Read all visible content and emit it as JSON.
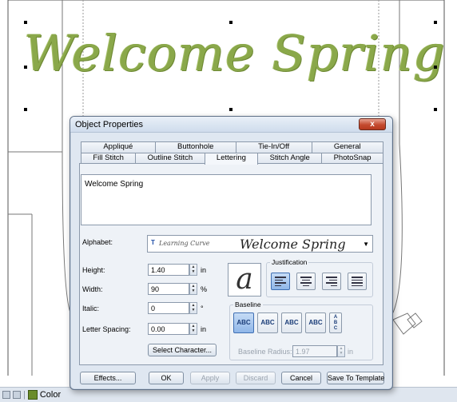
{
  "canvas": {
    "embroidery_text": "Welcome Spring"
  },
  "statusbar": {
    "color_label": "Color"
  },
  "dialog": {
    "title": "Object Properties",
    "close_label": "x",
    "tabs_row1": [
      "Appliqué",
      "Buttonhole",
      "Tie-In/Off",
      "General"
    ],
    "tabs_row2": [
      "Fill Stitch",
      "Outline Stitch",
      "Lettering",
      "Stitch Angle",
      "PhotoSnap"
    ],
    "active_tab": "Lettering",
    "text_value": "Welcome Spring",
    "alphabet_label": "Alphabet:",
    "alphabet_font_name": "Learning Curve",
    "alphabet_preview": "Welcome Spring",
    "height_label": "Height:",
    "height_value": "1.40",
    "height_unit": "in",
    "width_label": "Width:",
    "width_value": "90",
    "width_unit": "%",
    "italic_label": "Italic:",
    "italic_value": "0",
    "italic_unit": "°",
    "spacing_label": "Letter Spacing:",
    "spacing_value": "0.00",
    "spacing_unit": "in",
    "select_character_label": "Select Character...",
    "preview_glyph": "a",
    "justification_label": "Justification",
    "baseline_label": "Baseline",
    "baseline_buttons": [
      "ABC",
      "ABC",
      "ABC",
      "ABC",
      "ABC"
    ],
    "baseline_radius_label": "Baseline Radius:",
    "baseline_radius_value": "1.97",
    "baseline_radius_unit": "in",
    "footer": {
      "effects_label": "Effects...",
      "ok_label": "OK",
      "apply_label": "Apply",
      "discard_label": "Discard",
      "cancel_label": "Cancel",
      "save_template_label": "Save To Template"
    }
  }
}
